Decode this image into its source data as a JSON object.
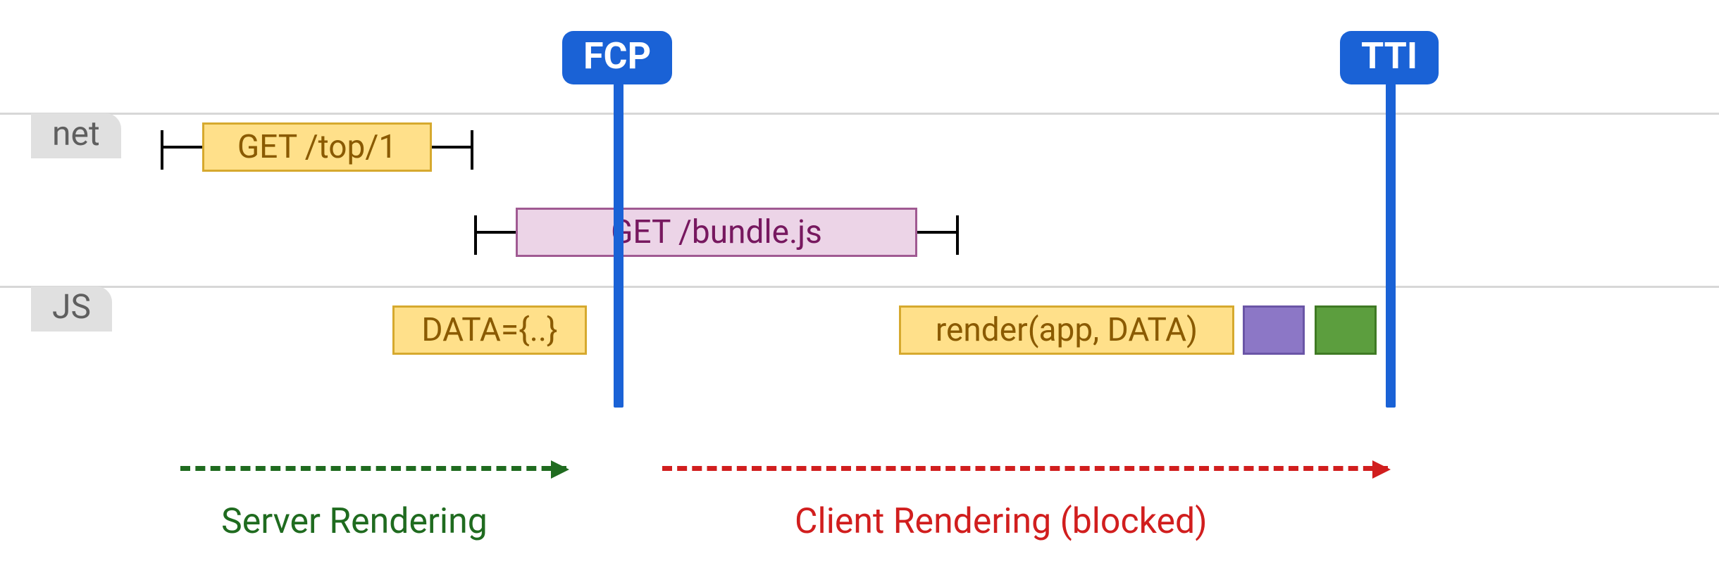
{
  "rows": {
    "net_label": "net",
    "js_label": "JS"
  },
  "markers": {
    "fcp": "FCP",
    "tti": "TTI"
  },
  "tasks": {
    "get_top": "GET /top/1",
    "get_bundle": "GET /bundle.js",
    "data_block": "DATA={..}",
    "render_call": "render(app, DATA)"
  },
  "phases": {
    "server": "Server Rendering",
    "client": "Client Rendering (blocked)"
  },
  "colors": {
    "marker_blue": "#1a62d6",
    "task_yellow_bg": "#ffe08a",
    "task_yellow_border": "#d6a92e",
    "task_pink_bg": "#ecd4e7",
    "task_pink_border": "#a05a92",
    "purple": "#8c77c6",
    "green_block": "#5c9e3e",
    "server_green": "#1f6b1f",
    "client_red": "#d11e1e"
  }
}
